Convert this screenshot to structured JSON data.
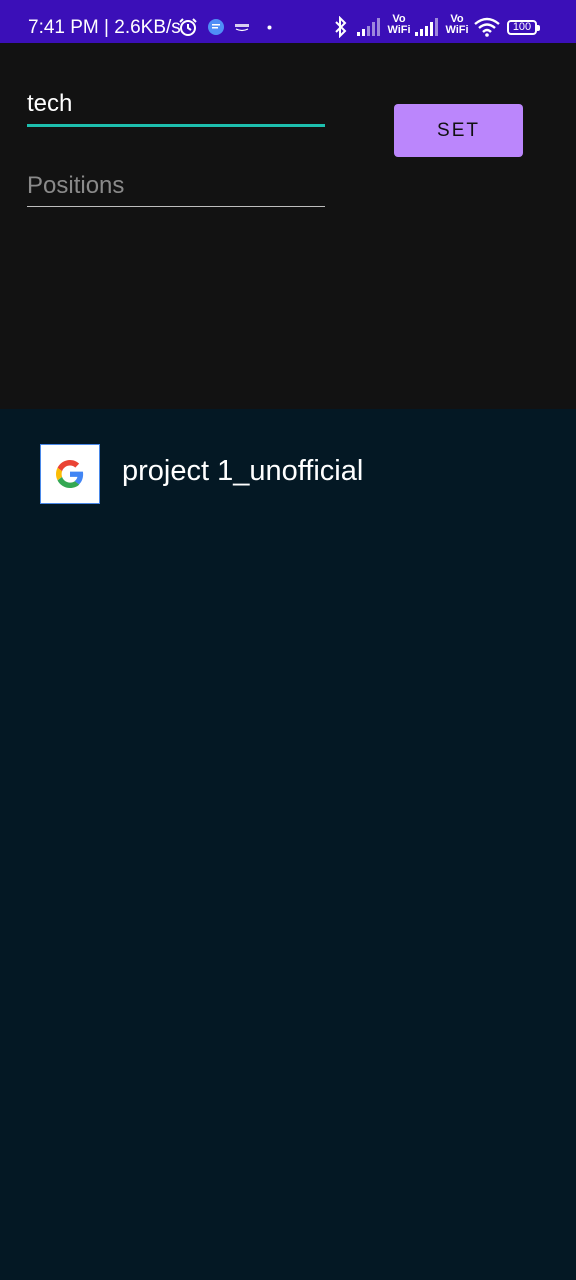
{
  "status_bar": {
    "time": "7:41 PM | 2.6KB/s",
    "vowifi_1": "Vo\nWiFi",
    "vowifi_2": "Vo\nWiFi",
    "battery": "100",
    "background_color": "#3b0fb8"
  },
  "form": {
    "tech_value": "tech",
    "positions_placeholder": "Positions",
    "set_label": "SET",
    "accent_color": "#1dbfae",
    "button_color": "#bb86fc"
  },
  "list": {
    "items": [
      {
        "icon": "google-icon",
        "label": "project 1_unofficial"
      }
    ]
  }
}
